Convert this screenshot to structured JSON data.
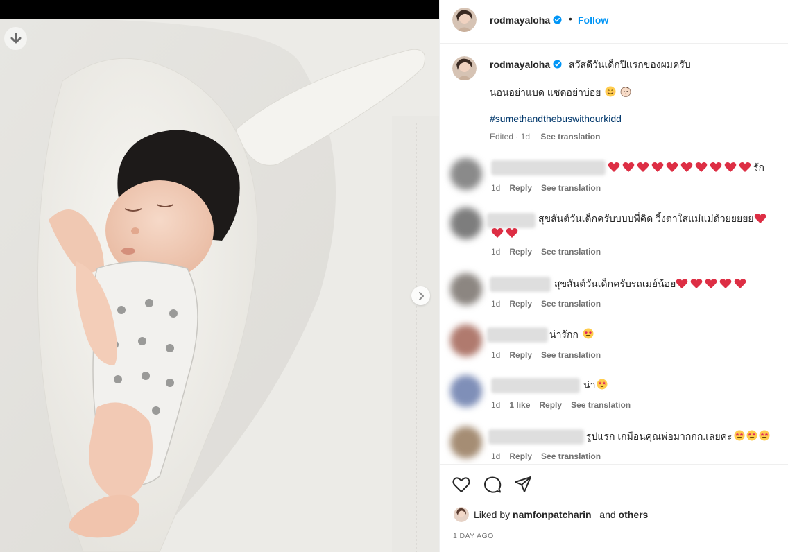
{
  "post": {
    "username": "rodmayaloha",
    "follow_label": "Follow",
    "dot": "•"
  },
  "caption": {
    "text": "สวัสดีวันเด็กปีแรกของผมครับ",
    "line2": "นอนอย่าแบด แซดอย่าบ่อย",
    "hashtag": "#sumethandthebuswithourkidd",
    "meta": "Edited · 1d",
    "see_translation": "See translation"
  },
  "comments": [
    {
      "text": "รัก",
      "hearts": 10,
      "time": "1d",
      "reply": "Reply",
      "see_translation": "See translation",
      "avatar_color": "#8a8a8a"
    },
    {
      "text": "สุขสันต์วันเด็กครับบบบพี่คิด วิ้งตาใส่แม่แม่ด้วยยยยย",
      "hearts_line2": 2,
      "time": "1d",
      "reply": "Reply",
      "see_translation": "See translation",
      "avatar_color": "#7d7d7d"
    },
    {
      "text": "สุขสันต์วันเด็กครับรถเมย์น้อย",
      "hearts": 5,
      "time": "1d",
      "reply": "Reply",
      "see_translation": "See translation",
      "avatar_color": "#8c8681"
    },
    {
      "text": "น่ารักก",
      "time": "1d",
      "reply": "Reply",
      "see_translation": "See translation",
      "avatar_color": "#b07a6e"
    },
    {
      "text": "น่า",
      "time": "1d",
      "likes": "1 like",
      "reply": "Reply",
      "see_translation": "See translation",
      "avatar_color": "#7f8fb8"
    },
    {
      "text": "รูปแรก เกมือนคุณพ่อมากกก.เลยค่ะ",
      "time": "1d",
      "reply": "Reply",
      "see_translation": "See translation",
      "avatar_color": "#a58d74"
    }
  ],
  "actions": {
    "like_icon": "heart-outline-icon",
    "comment_icon": "comment-bubble-icon",
    "share_icon": "paper-plane-icon"
  },
  "liked_by": {
    "prefix": "Liked by",
    "user": "namfonpatcharin_",
    "and": "and",
    "others": "others"
  },
  "date": "1 DAY AGO",
  "colors": {
    "link_blue": "#0095f6",
    "hashtag": "#00376b",
    "muted": "#737373",
    "heart_red": "#ed4956"
  }
}
